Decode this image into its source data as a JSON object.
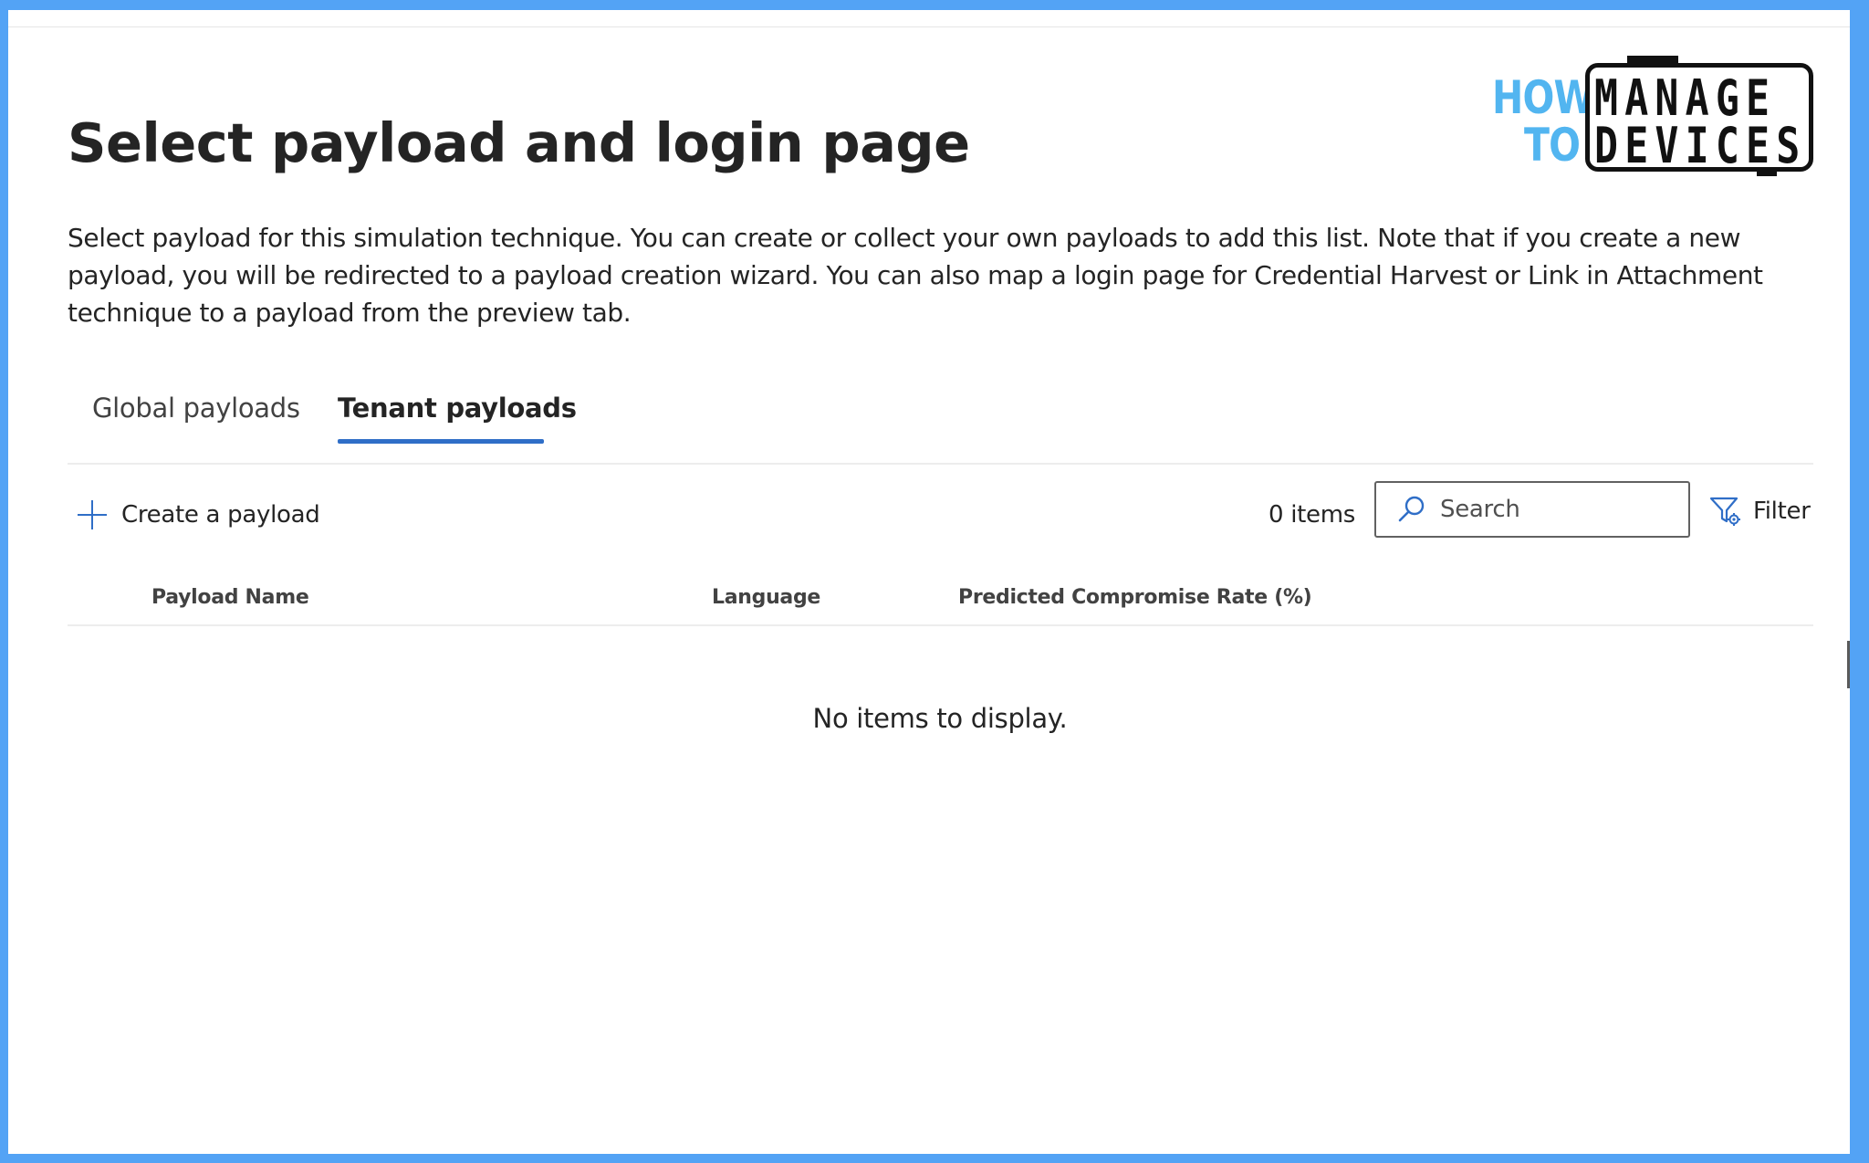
{
  "page": {
    "title": "Select payload and login page",
    "description": "Select payload for this simulation technique. You can create or collect your own payloads to add this list. Note that if you create a new payload, you will be redirected to a payload creation wizard. You can also map a login page for Credential Harvest or Link in Attachment technique to a payload from the preview tab."
  },
  "logo": {
    "how": "HOW",
    "to": "TO",
    "manage": "MANAGE",
    "devices": "DEVICES"
  },
  "tabs": [
    {
      "label": "Global payloads",
      "selected": false
    },
    {
      "label": "Tenant payloads",
      "selected": true
    }
  ],
  "toolbar": {
    "create_label": "Create a payload",
    "create_icon": "plus-icon",
    "items_count": "0 items",
    "search_placeholder": "Search",
    "search_value": "",
    "search_icon": "search-icon",
    "filter_label": "Filter",
    "filter_icon": "filter-icon"
  },
  "table": {
    "columns": [
      "Payload Name",
      "Language",
      "Predicted Compromise Rate (%)"
    ],
    "rows": [],
    "empty_message": "No items to display."
  },
  "colors": {
    "frame": "#53a3f5",
    "accent": "#2f6ec7",
    "logo_blue": "#52b5f0",
    "text": "#242424"
  }
}
